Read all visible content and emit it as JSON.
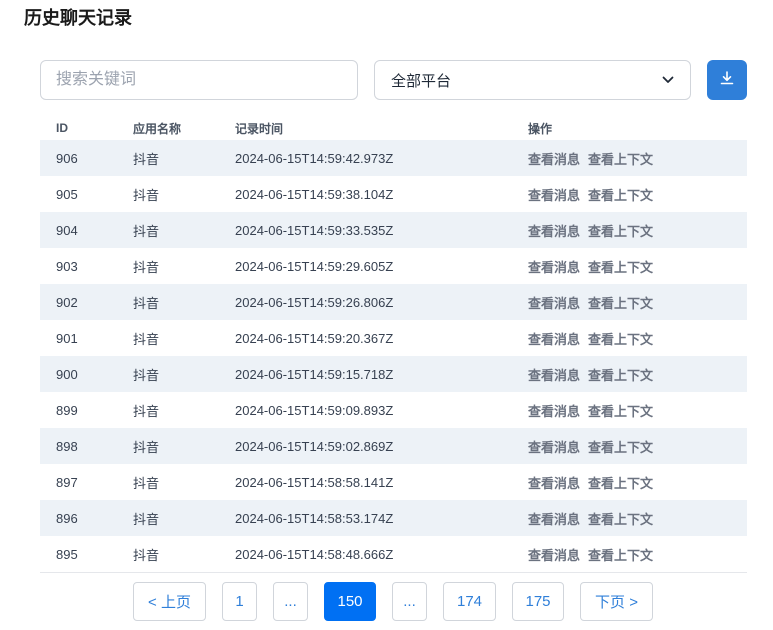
{
  "header": {
    "title": "历史聊天记录"
  },
  "filters": {
    "search_placeholder": "搜索关键词",
    "platform_value": "全部平台"
  },
  "icons": {
    "download": "download-icon",
    "chevron": "chevron-down-icon"
  },
  "colors": {
    "accent": "#2f7fd9",
    "active_page": "#0070f3",
    "stripe": "#edf2f7"
  },
  "table": {
    "columns": [
      "ID",
      "应用名称",
      "记录时间",
      "操作"
    ],
    "actions": [
      "查看消息",
      "查看上下文"
    ],
    "rows": [
      {
        "id": "906",
        "app": "抖音",
        "time": "2024-06-15T14:59:42.973Z"
      },
      {
        "id": "905",
        "app": "抖音",
        "time": "2024-06-15T14:59:38.104Z"
      },
      {
        "id": "904",
        "app": "抖音",
        "time": "2024-06-15T14:59:33.535Z"
      },
      {
        "id": "903",
        "app": "抖音",
        "time": "2024-06-15T14:59:29.605Z"
      },
      {
        "id": "902",
        "app": "抖音",
        "time": "2024-06-15T14:59:26.806Z"
      },
      {
        "id": "901",
        "app": "抖音",
        "time": "2024-06-15T14:59:20.367Z"
      },
      {
        "id": "900",
        "app": "抖音",
        "time": "2024-06-15T14:59:15.718Z"
      },
      {
        "id": "899",
        "app": "抖音",
        "time": "2024-06-15T14:59:09.893Z"
      },
      {
        "id": "898",
        "app": "抖音",
        "time": "2024-06-15T14:59:02.869Z"
      },
      {
        "id": "897",
        "app": "抖音",
        "time": "2024-06-15T14:58:58.141Z"
      },
      {
        "id": "896",
        "app": "抖音",
        "time": "2024-06-15T14:58:53.174Z"
      },
      {
        "id": "895",
        "app": "抖音",
        "time": "2024-06-15T14:58:48.666Z"
      }
    ]
  },
  "pagination": {
    "items": [
      {
        "label": "< 上页",
        "active": false
      },
      {
        "label": "1",
        "active": false
      },
      {
        "label": "...",
        "active": false
      },
      {
        "label": "150",
        "active": true
      },
      {
        "label": "...",
        "active": false
      },
      {
        "label": "174",
        "active": false
      },
      {
        "label": "175",
        "active": false
      },
      {
        "label": "下页 >",
        "active": false
      }
    ]
  }
}
